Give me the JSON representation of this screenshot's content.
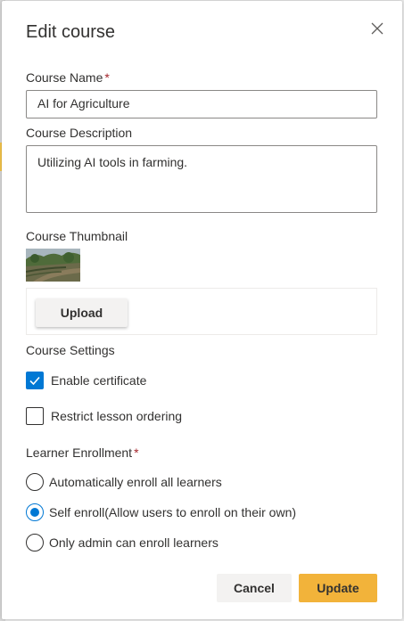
{
  "dialog": {
    "title": "Edit course",
    "close_icon": "close-icon"
  },
  "course_name": {
    "label": "Course Name",
    "required_marker": "*",
    "value": "AI for Agriculture"
  },
  "course_description": {
    "label": "Course Description",
    "value": "Utilizing AI tools in farming."
  },
  "course_thumbnail": {
    "label": "Course Thumbnail",
    "upload_label": "Upload"
  },
  "course_settings": {
    "label": "Course Settings",
    "options": [
      {
        "label": "Enable certificate",
        "checked": true
      },
      {
        "label": "Restrict lesson ordering",
        "checked": false
      }
    ]
  },
  "learner_enrollment": {
    "label": "Learner Enrollment",
    "required_marker": "*",
    "options": [
      {
        "label": "Automatically enroll all learners",
        "selected": false
      },
      {
        "label": "Self enroll(Allow users to enroll on their own)",
        "selected": true
      },
      {
        "label": "Only admin can enroll learners",
        "selected": false
      }
    ]
  },
  "footer": {
    "cancel_label": "Cancel",
    "update_label": "Update"
  },
  "colors": {
    "accent_blue": "#0078d4",
    "update_button": "#f2b33a",
    "required_red": "#a4262c"
  }
}
